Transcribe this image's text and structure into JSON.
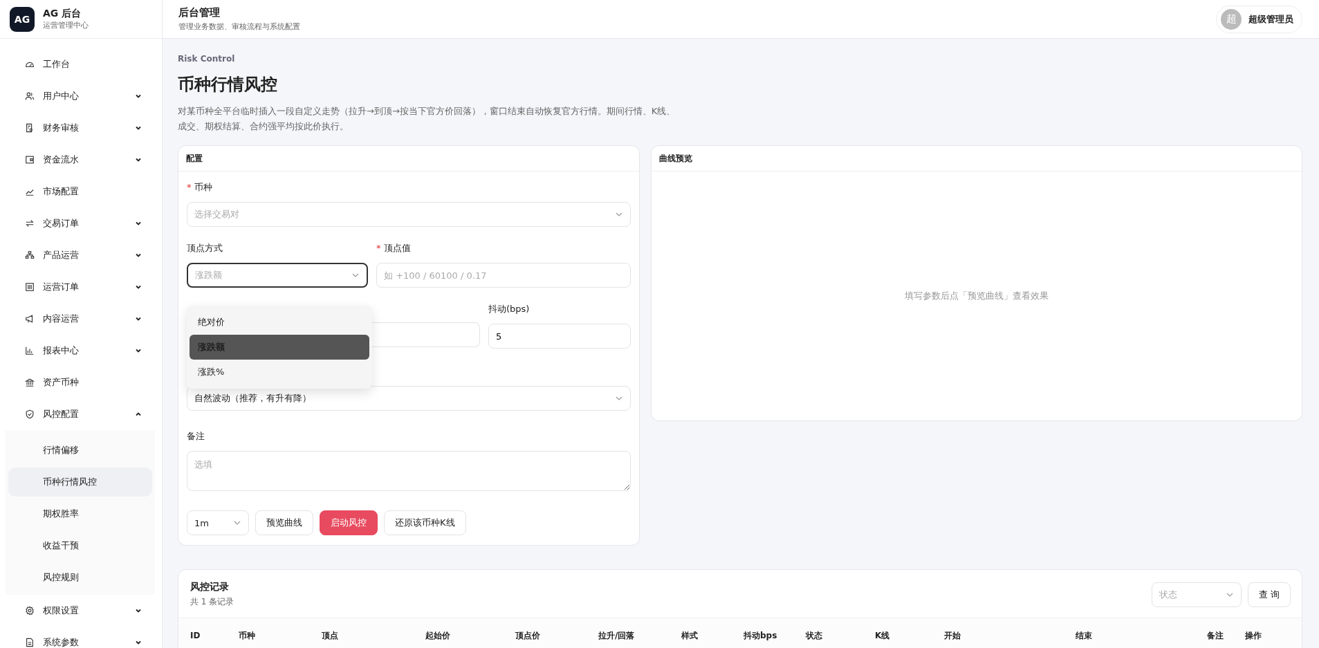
{
  "brand": {
    "logo": "AG",
    "title": "AG 后台",
    "subtitle": "运营管理中心"
  },
  "header": {
    "title": "后台管理",
    "subtitle": "管理业务数据、审核流程与系统配置",
    "user": {
      "avatar": "超",
      "name": "超级管理员"
    }
  },
  "sidebar": {
    "items": [
      {
        "label": "工作台"
      },
      {
        "label": "用户中心",
        "expanded": false
      },
      {
        "label": "财务审核",
        "expanded": false
      },
      {
        "label": "资金流水",
        "expanded": false
      },
      {
        "label": "市场配置"
      },
      {
        "label": "交易订单",
        "expanded": false
      },
      {
        "label": "产品运营",
        "expanded": false
      },
      {
        "label": "运营订单",
        "expanded": false
      },
      {
        "label": "内容运营",
        "expanded": false
      },
      {
        "label": "报表中心",
        "expanded": false
      },
      {
        "label": "资产币种"
      },
      {
        "label": "风控配置",
        "expanded": true,
        "children": [
          {
            "label": "行情偏移",
            "selected": false
          },
          {
            "label": "币种行情风控",
            "selected": true
          },
          {
            "label": "期权胜率",
            "selected": false
          },
          {
            "label": "收益干预",
            "selected": false
          },
          {
            "label": "风控规则",
            "selected": false
          }
        ]
      },
      {
        "label": "权限设置",
        "expanded": false
      },
      {
        "label": "系统参数",
        "expanded": false
      }
    ]
  },
  "page": {
    "eyebrow": "Risk Control",
    "title": "币种行情风控",
    "description": "对某币种全平台临时插入一段自定义走势（拉升→到顶→按当下官方价回落），窗口结束自动恢复官方行情。期间行情、K线、成交、期权结算、合约强平均按此价执行。"
  },
  "config": {
    "title": "配置",
    "symbol": {
      "required_mark": "*",
      "label": "币种",
      "placeholder": "选择交易对"
    },
    "peak_mode": {
      "label": "顶点方式",
      "placeholder": "涨跌额",
      "open": true,
      "options": [
        {
          "label": "绝对价",
          "selected": false
        },
        {
          "label": "涨跌额",
          "selected": true
        },
        {
          "label": "涨跌%",
          "selected": false
        }
      ]
    },
    "peak_value": {
      "required_mark": "*",
      "label": "顶点值",
      "placeholder": "如 +100 / 60100 / 0.17"
    },
    "jitter": {
      "label": "抖动(bps)",
      "value": "5"
    },
    "kline_style": {
      "value": "自然波动（推荐，有升有降）"
    },
    "note": {
      "label": "备注",
      "placeholder": "选填"
    },
    "interval": {
      "value": "1m"
    },
    "buttons": [
      {
        "label": "预览曲线",
        "kind": "default"
      },
      {
        "label": "启动风控",
        "kind": "danger"
      },
      {
        "label": "还原该币种K线",
        "kind": "default"
      }
    ]
  },
  "preview": {
    "title": "曲线预览",
    "empty_text": "填写参数后点「预览曲线」查看效果"
  },
  "records": {
    "title": "风控记录",
    "count": "共 1 条记录",
    "status_filter": {
      "placeholder": "状态"
    },
    "query_button": "查 询",
    "columns": [
      "ID",
      "币种",
      "顶点",
      "起始价",
      "顶点价",
      "拉升/回落",
      "样式",
      "抖动bps",
      "状态",
      "K线",
      "开始",
      "结束",
      "备注",
      "操作"
    ]
  }
}
